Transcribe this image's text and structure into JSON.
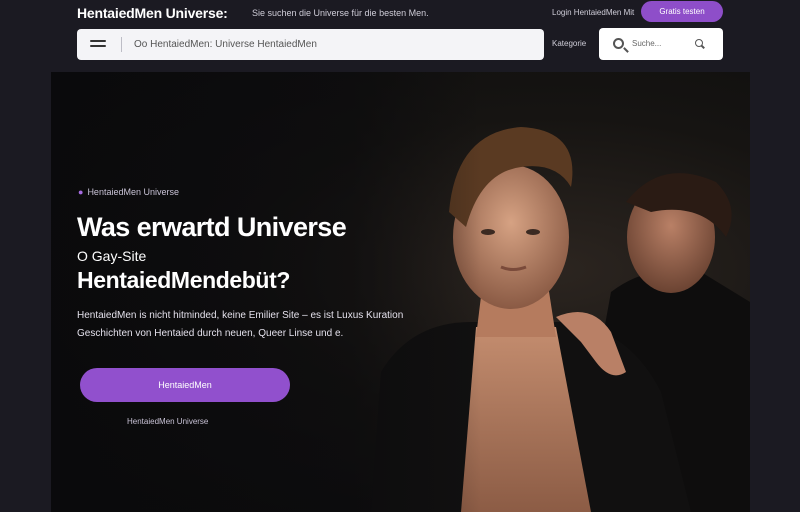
{
  "header": {
    "brand": "HentaiedMen Universe:",
    "tagline": "Sie suchen die Universe für die besten Men.",
    "login_link": "Login  HentaiedMen Mit",
    "cta_label": "Gratis testen"
  },
  "search": {
    "query": "Oo HentaiedMen: Universe HentaiedMen",
    "filter_label": "Kategorie",
    "secondary_placeholder": "Suche...",
    "icons": [
      "menu-icon",
      "search-icon"
    ]
  },
  "hero": {
    "eyebrow": "HentaiedMen Universe",
    "title_line1": "Was erwartd Universe",
    "title_sub": "O Gay-Site",
    "title_line2": "HentaiedMendebüt?",
    "desc_line1": "HentaiedMen is nicht hitminded, keine Emilier Site – es ist Luxus Kuration",
    "desc_line2": "Geschichten von Hentaied durch neuen, Queer Linse und e.",
    "cta_label": "HentaiedMen",
    "note": "HentaiedMen Universe"
  },
  "colors": {
    "accent": "#8e4ec9",
    "background": "#1b1a22"
  }
}
